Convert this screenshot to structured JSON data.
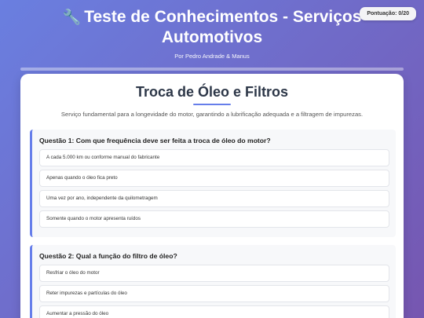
{
  "score": {
    "label": "Pontuação: 0/20"
  },
  "header": {
    "icon": "wrench-icon",
    "title": "Teste de Conhecimentos - Serviços Automotivos",
    "subtitle": "Por Pedro Andrade & Manus",
    "progress_fraction": 0
  },
  "section": {
    "title": "Troca de Óleo e Filtros",
    "description": "Serviço fundamental para a longevidade do motor, garantindo a lubrificação adequada e a filtragem de impurezas."
  },
  "questions": [
    {
      "text": "Questão 1: Com que frequência deve ser feita a troca de óleo do motor?",
      "options": [
        "A cada 5.000 km ou conforme manual do fabricante",
        "Apenas quando o óleo fica preto",
        "Uma vez por ano, independente da quilometragem",
        "Somente quando o motor apresenta ruídos"
      ]
    },
    {
      "text": "Questão 2: Qual a função do filtro de óleo?",
      "options": [
        "Resfriar o óleo do motor",
        "Reter impurezas e partículas do óleo",
        "Aumentar a pressão do óleo"
      ]
    }
  ],
  "colors": {
    "accent": "#667eea",
    "bg_start": "#6a7fe0",
    "bg_end": "#7656b0"
  }
}
